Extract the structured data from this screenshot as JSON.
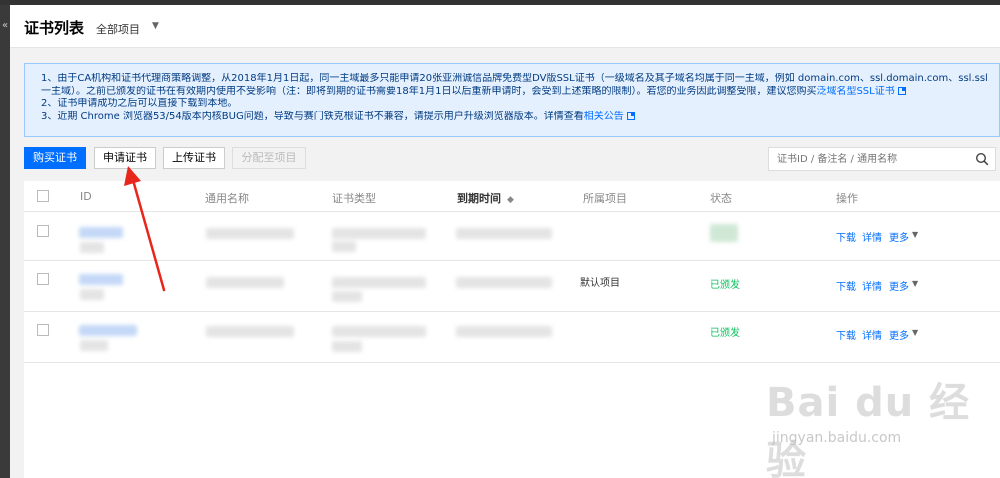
{
  "sidebar": {
    "collapse_glyph": "«"
  },
  "header": {
    "title": "证书列表",
    "project_selector": "全部项目"
  },
  "notice": {
    "line1": "1、由于CA机构和证书代理商策略调整，从2018年1月1日起，同一主域最多只能申请20张亚洲诚信品牌免费型DV版SSL证书（一级域名及其子域名均属于同一主域，例如 domain.com、ssl.domain.com、ssl.ssl.domain.com 都属于同",
    "line2": "一主域）。之前已颁发的证书在有效期内使用不受影响（注：即将到期的证书需要18年1月1日以后重新申请时，会受到上述策略的限制）。若您的业务因此调整受限，建议您购买",
    "line2_link": "泛域名型SSL证书",
    "line3": "2、证书申请成功之后可以直接下载到本地。",
    "line4": "3、近期 Chrome 浏览器53/54版本内核BUG问题，导致与赛门铁克根证书不兼容，请提示用户升级浏览器版本。详情查看",
    "line4_link": "相关公告"
  },
  "toolbar": {
    "buy": "购买证书",
    "apply": "申请证书",
    "upload": "上传证书",
    "assign": "分配至项目",
    "search_placeholder": "证书ID / 备注名 / 通用名称"
  },
  "table": {
    "columns": {
      "id": "ID",
      "name": "通用名称",
      "type": "证书类型",
      "expire": "到期时间",
      "project": "所属项目",
      "status": "状态",
      "ops": "操作"
    },
    "rows": [
      {
        "project": "",
        "status": ""
      },
      {
        "project": "默认项目",
        "status": "已颁发"
      },
      {
        "project": "",
        "status": "已颁发"
      }
    ],
    "ops": {
      "download": "下载",
      "detail": "详情",
      "more": "更多"
    }
  },
  "watermark": {
    "logo": "Bai du 经验",
    "url": "jingyan.baidu.com"
  },
  "colors": {
    "primary": "#006eff",
    "success": "#0abf5b",
    "annotation": "#e8261c"
  }
}
